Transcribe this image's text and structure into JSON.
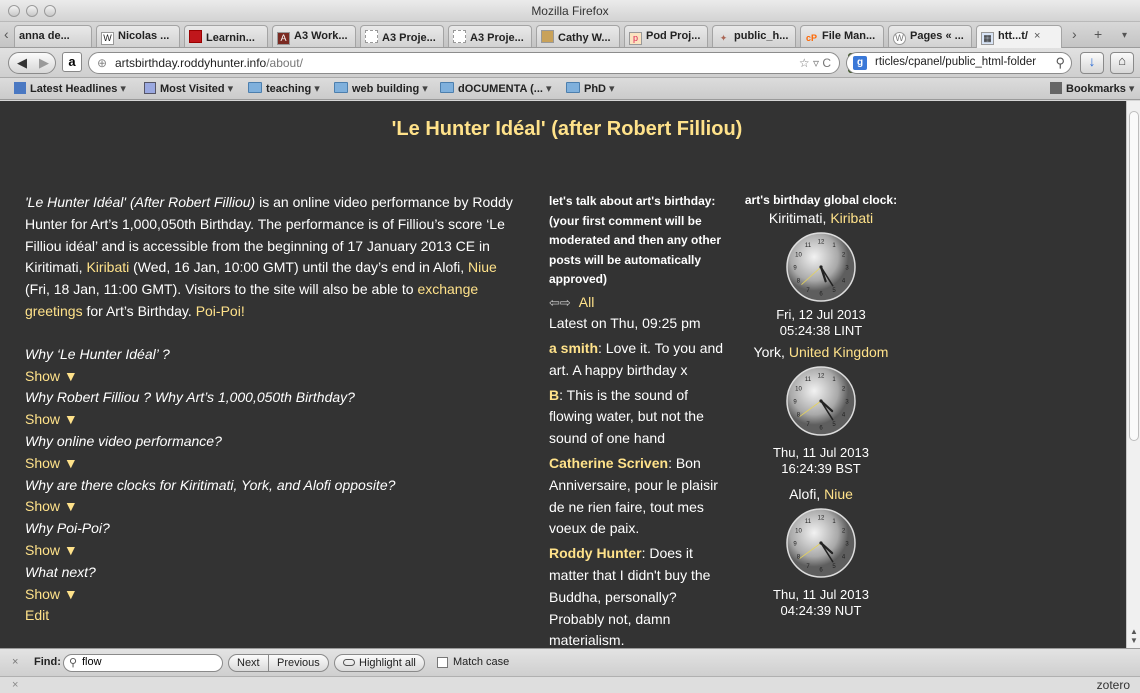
{
  "window": {
    "title": "Mozilla Firefox"
  },
  "tabs": [
    {
      "label": "anna de...",
      "icon": "doc-icon",
      "active": false
    },
    {
      "label": "Nicolas ...",
      "icon": "wikipedia-icon",
      "active": false
    },
    {
      "label": "Learnin...",
      "icon": "red-square-icon",
      "active": false
    },
    {
      "label": "A3 Work...",
      "icon": "a3-icon",
      "active": false
    },
    {
      "label": "A3 Proje...",
      "icon": "blank-page-icon",
      "active": false
    },
    {
      "label": "A3 Proje...",
      "icon": "blank-page-icon",
      "active": false
    },
    {
      "label": "Cathy W...",
      "icon": "site-icon",
      "active": false
    },
    {
      "label": "Pod Proj...",
      "icon": "pod-icon",
      "active": false
    },
    {
      "label": "public_h...",
      "icon": "script-icon",
      "active": false
    },
    {
      "label": "File Man...",
      "icon": "cpanel-icon",
      "active": false
    },
    {
      "label": "Pages « ...",
      "icon": "wordpress-icon",
      "active": false
    },
    {
      "label": "htt...t/",
      "icon": "grid-icon",
      "active": true
    }
  ],
  "nav": {
    "url_host": "artsbirthday.roddyhunter.info",
    "url_path": "/about/",
    "search_value": "rticles/cpanel/public_html-folder"
  },
  "bookmarks": [
    {
      "label": "Latest Headlines",
      "icon": "rss-icon"
    },
    {
      "label": "Most Visited",
      "icon": "star-folder-icon"
    },
    {
      "label": "teaching",
      "icon": "folder-icon"
    },
    {
      "label": "web building",
      "icon": "folder-icon"
    },
    {
      "label": "dOCUMENTA (...",
      "icon": "folder-icon"
    },
    {
      "label": "PhD",
      "icon": "folder-icon"
    }
  ],
  "bookmarks_menu": "Bookmarks",
  "page": {
    "title": "'Le Hunter Idéal' (after Robert Filliou)",
    "intro": {
      "em": "'Le Hunter Idéal' (After Robert Filliou)",
      "t1": " is an online video performance by Roddy Hunter for Art’s 1,000,050th Birthday. The performance is of Filliou’s score ‘Le Filliou idéal’ and is accessible from the beginning of 17 January 2013 CE in Kiritimati, ",
      "l1": "Kiribati",
      "t2": " (Wed, 16 Jan, 10:00 GMT) until the day’s end in Alofi, ",
      "l2": "Niue",
      "t3": " (Fri, 18 Jan, 11:00 GMT). Visitors to the site will also be able to ",
      "l3": "exchange greetings",
      "t4": " for Art’s Birthday. ",
      "l4": "Poi-Poi!"
    },
    "faq": [
      {
        "q": "Why ‘Le Hunter Idéal’ ?",
        "show": "Show ▼"
      },
      {
        "q": "Why Robert Filliou ? Why Art’s 1,000,050th Birthday?",
        "show": "Show ▼"
      },
      {
        "q": "Why online video performance?",
        "show": "Show ▼"
      },
      {
        "q": "Why are there clocks for Kiritimati, York, and Alofi opposite?",
        "show": "Show ▼"
      },
      {
        "q": "Why Poi-Poi?",
        "show": "Show ▼"
      },
      {
        "q": "What next?",
        "show": "Show ▼"
      }
    ],
    "edit": "Edit"
  },
  "comments": {
    "heading": "let's talk about art's birthday: (your first comment will be moderated and then any other posts will be automatically approved)",
    "all": "All",
    "latest": "Latest on Thu, 09:25 pm",
    "items": [
      {
        "author": "a smith",
        "text": ": Love it. To you and art. A happy birthday x"
      },
      {
        "author": "B",
        "text": ": This is the sound of flowing water, but not the sound of one hand"
      },
      {
        "author": "Catherine Scriven",
        "text": ": Bon Anniversaire, pour le plaisir de ne rien faire, tout mes voeux de paix."
      },
      {
        "author": "Roddy Hunter",
        "text": ": Does it matter that I didn't buy the Buddha, personally? Probably not, damn materialism."
      }
    ]
  },
  "clocks": {
    "heading": "art's birthday global clock:",
    "items": [
      {
        "city": "Kiritimati, ",
        "country": "Kiribati",
        "line1": "Fri, 12 Jul 2013",
        "line2": "05:24:38 LINT",
        "h": 5,
        "m": 24,
        "s": 38
      },
      {
        "city": "York, ",
        "country": "United Kingdom",
        "line1": "Thu, 11 Jul 2013",
        "line2": "16:24:39 BST",
        "h": 16,
        "m": 24,
        "s": 39
      },
      {
        "city": "Alofi, ",
        "country": "Niue",
        "line1": "Thu, 11 Jul 2013",
        "line2": "04:24:39 NUT",
        "h": 4,
        "m": 24,
        "s": 39
      }
    ]
  },
  "findbar": {
    "label": "Find:",
    "value": "flow",
    "next": "Next",
    "previous": "Previous",
    "highlight": "Highlight all",
    "matchcase": "Match case"
  },
  "statusbar": {
    "zotero": "zotero"
  },
  "colors": {
    "page_bg": "#333333",
    "link": "#ffe28a"
  }
}
